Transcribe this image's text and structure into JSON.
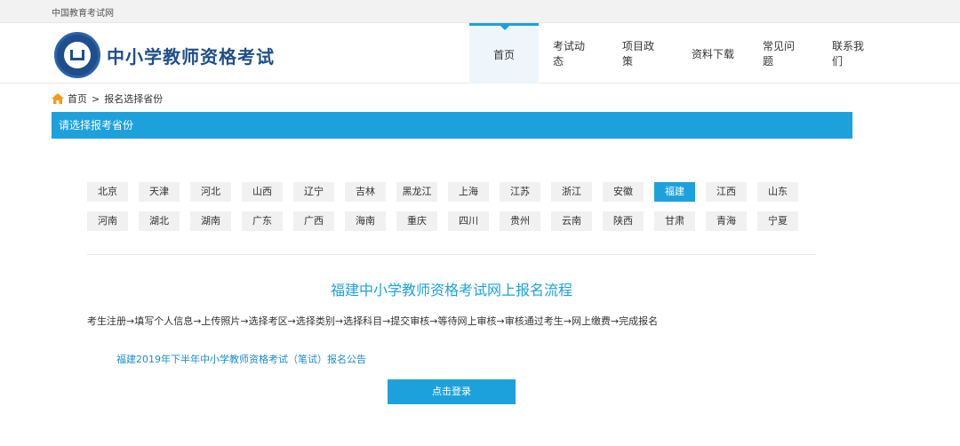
{
  "topbar": {
    "text": "中国教育考试网"
  },
  "header": {
    "site_title": "中小学教师资格考试",
    "nav": [
      "首页",
      "考试动态",
      "项目政策",
      "资料下载",
      "常见问题",
      "联系我们"
    ],
    "active_index": 0
  },
  "breadcrumb": {
    "home": "首页",
    "separator": ">",
    "current": "报名选择省份"
  },
  "banner": {
    "title": "请选择报考省份"
  },
  "provinces": {
    "row1": [
      "北京",
      "天津",
      "河北",
      "山西",
      "辽宁",
      "吉林",
      "黑龙江",
      "上海",
      "江苏",
      "浙江",
      "安徽",
      "福建",
      "江西",
      "山东"
    ],
    "row2": [
      "河南",
      "湖北",
      "湖南",
      "广东",
      "广西",
      "海南",
      "重庆",
      "四川",
      "贵州",
      "云南",
      "陕西",
      "甘肃",
      "青海",
      "宁夏"
    ],
    "selected": "福建"
  },
  "flow": {
    "title": "福建中小学教师资格考试网上报名流程",
    "steps": "考生注册→填写个人信息→上传照片→选择考区→选择类别→选择科目→提交审核→等待网上审核→审核通过考生→网上缴费→完成报名"
  },
  "notice": {
    "link": "福建2019年下半年中小学教师资格考试（笔试）报名公告"
  },
  "login": {
    "label": "点击登录"
  },
  "colors": {
    "accent": "#1da1dc",
    "brand": "#1f4f8a"
  }
}
